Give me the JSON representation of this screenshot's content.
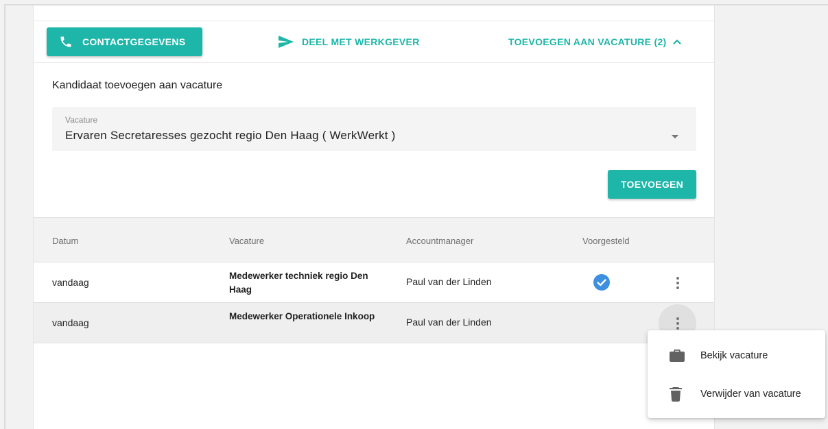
{
  "actions": {
    "contact_label": "CONTACTGEGEVENS",
    "share_label": "DEEL MET WERKGEVER",
    "add_toggle_label": "TOEVOEGEN AAN VACATURE (2)"
  },
  "add_section": {
    "title": "Kandidaat toevoegen aan vacature",
    "select_label": "Vacature",
    "select_value": "Ervaren Secretaresses gezocht regio Den Haag ( WerkWerkt )",
    "submit_label": "TOEVOEGEN"
  },
  "table": {
    "headers": [
      "Datum",
      "Vacature",
      "Accountmanager",
      "Voorgesteld"
    ],
    "rows": [
      {
        "date": "vandaag",
        "vacancy": "Medewerker techniek regio Den Haag",
        "account_manager": "Paul van der Linden",
        "proposed": true
      },
      {
        "date": "vandaag",
        "vacancy": "Medewerker Operationele Inkoop",
        "account_manager": "Paul van der Linden",
        "proposed": false
      }
    ]
  },
  "context_menu": {
    "items": [
      {
        "label": "Bekijk vacature",
        "icon": "briefcase-icon"
      },
      {
        "label": "Verwijder van vacature",
        "icon": "trash-icon"
      }
    ]
  },
  "colors": {
    "accent": "#1db6a9",
    "check": "#3d8fe0"
  }
}
